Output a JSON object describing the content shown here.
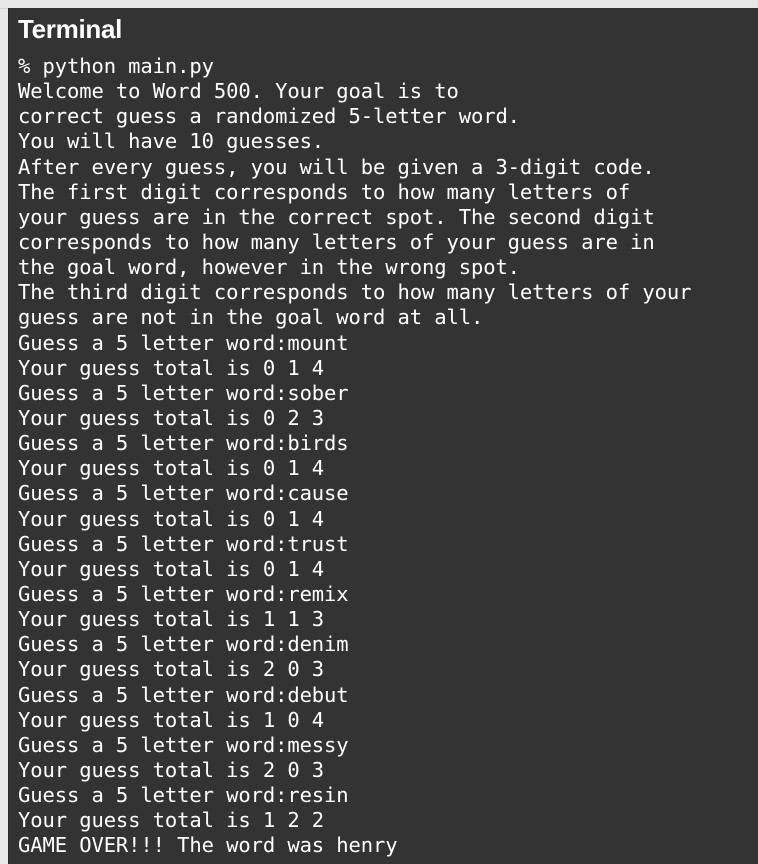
{
  "window": {
    "title": "Terminal"
  },
  "terminal": {
    "lines": [
      "% python main.py",
      "Welcome to Word 500. Your goal is to",
      "correct guess a randomized 5-letter word.",
      "You will have 10 guesses.",
      "After every guess, you will be given a 3-digit code.",
      "The first digit corresponds to how many letters of",
      "your guess are in the correct spot. The second digit",
      "corresponds to how many letters of your guess are in",
      "the goal word, however in the wrong spot.",
      "The third digit corresponds to how many letters of your",
      "guess are not in the goal word at all.",
      "Guess a 5 letter word:mount",
      "Your guess total is 0 1 4",
      "Guess a 5 letter word:sober",
      "Your guess total is 0 2 3",
      "Guess a 5 letter word:birds",
      "Your guess total is 0 1 4",
      "Guess a 5 letter word:cause",
      "Your guess total is 0 1 4",
      "Guess a 5 letter word:trust",
      "Your guess total is 0 1 4",
      "Guess a 5 letter word:remix",
      "Your guess total is 1 1 3",
      "Guess a 5 letter word:denim",
      "Your guess total is 2 0 3",
      "Guess a 5 letter word:debut",
      "Your guess total is 1 0 4",
      "Guess a 5 letter word:messy",
      "Your guess total is 2 0 3",
      "Guess a 5 letter word:resin",
      "Your guess total is 1 2 2",
      "GAME OVER!!! The word was henry"
    ]
  }
}
